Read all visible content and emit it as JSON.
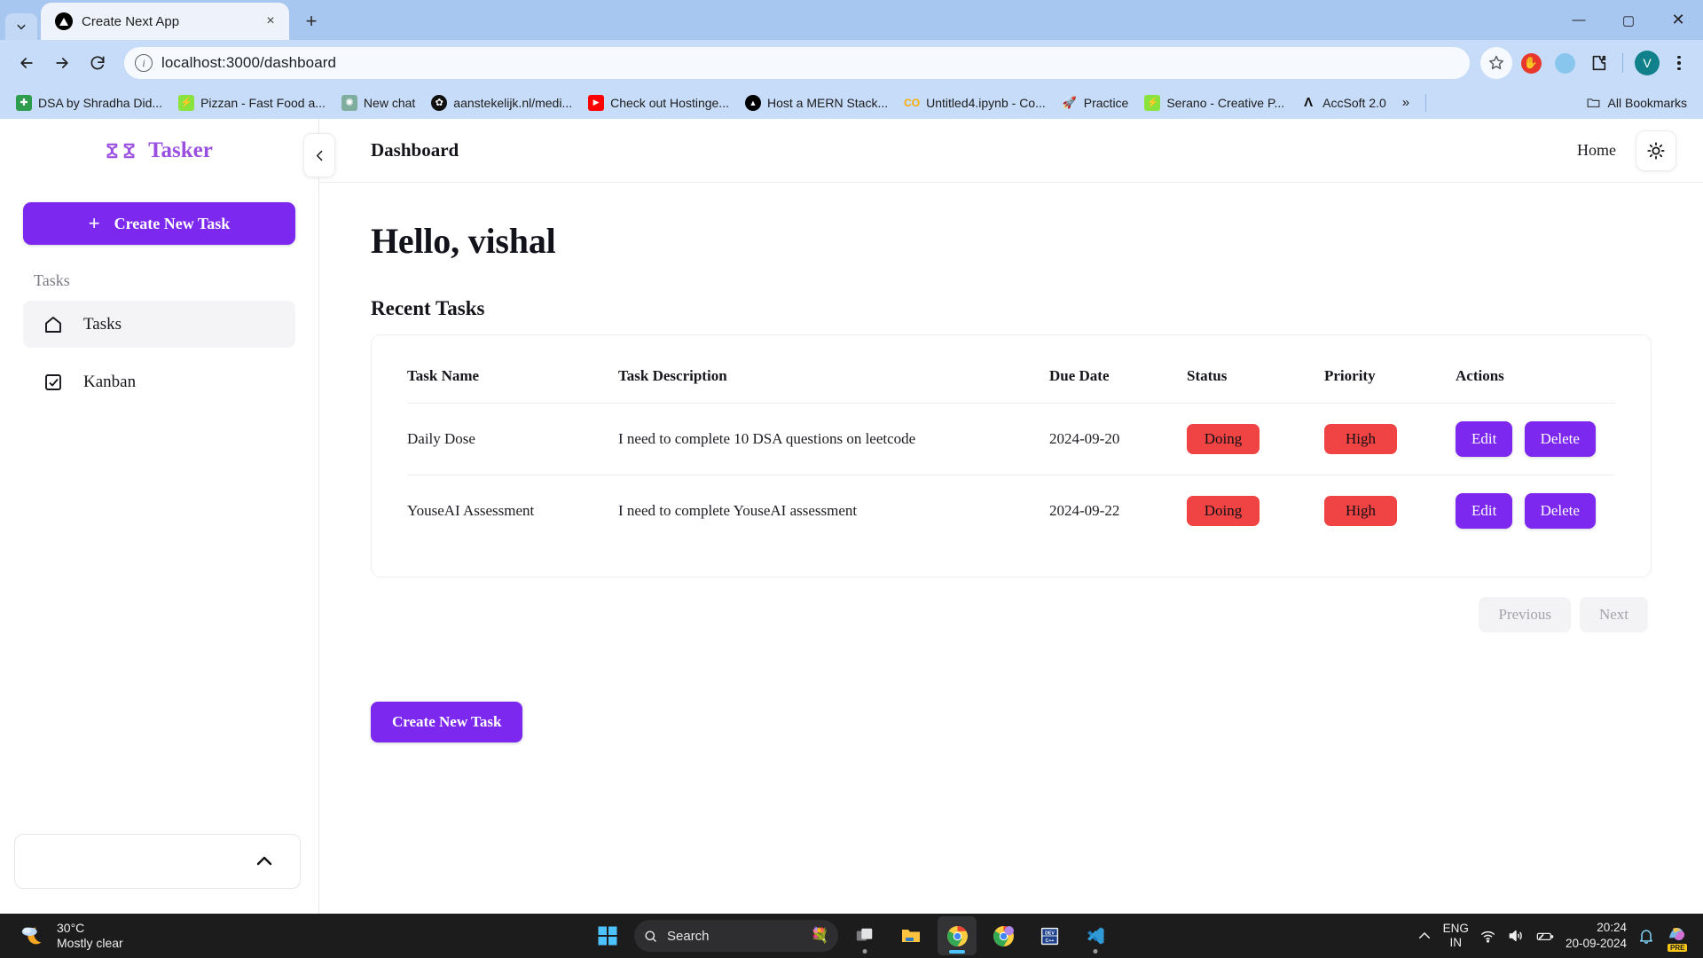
{
  "browser": {
    "tab": {
      "title": "Create Next App",
      "favicon": "nextjs-icon",
      "close": "×"
    },
    "new_tab_label": "+",
    "window_controls": {
      "minimize": "—",
      "maximize": "▢",
      "close": "✕"
    },
    "url": {
      "scheme_hidden": "",
      "text": "localhost:3000/dashboard",
      "host": "localhost:3000",
      "path": "/dashboard"
    },
    "nav": {
      "back": "back-arrow",
      "forward": "forward-arrow",
      "reload": "reload-icon"
    },
    "toolbar_icons": [
      "star-icon",
      "adblock-icon",
      "extension-blue-icon",
      "extensions-puzzle-icon",
      "profile-avatar",
      "chrome-menu-icon"
    ],
    "profile_initial": "V",
    "bookmarks": [
      {
        "label": "DSA by Shradha Did...",
        "icon": "doc-green-icon",
        "color": "#2e9e4e",
        "glyph": "✚"
      },
      {
        "label": "Pizzan - Fast Food a...",
        "icon": "pizzan-icon",
        "color": "#7fe03a",
        "glyph": "⚡"
      },
      {
        "label": "New chat",
        "icon": "chatgpt-icon",
        "color": "#74aa9c",
        "glyph": "✺"
      },
      {
        "label": "aanstekelijk.nl/medi...",
        "icon": "globe-dark-icon",
        "color": "#1a1a1a",
        "glyph": "✿"
      },
      {
        "label": "Check out Hostinge...",
        "icon": "youtube-icon",
        "color": "#ff0000",
        "glyph": "▶"
      },
      {
        "label": "Host a MERN Stack...",
        "icon": "vercel-icon",
        "color": "#000000",
        "glyph": "▲"
      },
      {
        "label": "Untitled4.ipynb - Co...",
        "icon": "colab-icon",
        "color": "#f9ab00",
        "glyph": "CO"
      },
      {
        "label": "Practice",
        "icon": "rocket-icon",
        "color": "#e8f0fe",
        "glyph": "🚀"
      },
      {
        "label": "Serano - Creative P...",
        "icon": "serano-icon",
        "color": "#7fe03a",
        "glyph": "⚡"
      },
      {
        "label": "AccSoft 2.0",
        "icon": "accsoft-icon",
        "color": "#ffffff",
        "glyph": "A"
      }
    ],
    "overflow_label": "»",
    "all_bookmarks_label": "All Bookmarks"
  },
  "sidebar": {
    "brand": {
      "name": "Tasker",
      "logo": "tasker-ticket-icon"
    },
    "create_button": {
      "label": "Create New Task",
      "icon": "plus-icon"
    },
    "section_label": "Tasks",
    "items": [
      {
        "label": "Tasks",
        "icon": "home-icon",
        "active": true
      },
      {
        "label": "Kanban",
        "icon": "checkbox-icon",
        "active": false
      }
    ],
    "footer": {
      "icon": "chevron-up-icon"
    },
    "collapse_icon": "chevron-left-icon"
  },
  "topbar": {
    "title": "Dashboard",
    "home_label": "Home",
    "theme_toggle_icon": "sun-icon"
  },
  "main": {
    "greeting": "Hello, vishal",
    "recent_title": "Recent Tasks",
    "table": {
      "headers": [
        "Task Name",
        "Task Description",
        "Due Date",
        "Status",
        "Priority",
        "Actions"
      ],
      "rows": [
        {
          "name": "Daily Dose",
          "description": "I need to complete 10 DSA questions on leetcode",
          "due_date": "2024-09-20",
          "status": "Doing",
          "priority": "High",
          "edit_label": "Edit",
          "delete_label": "Delete"
        },
        {
          "name": "YouseAI Assessment",
          "description": "I need to complete YouseAI assessment",
          "due_date": "2024-09-22",
          "status": "Doing",
          "priority": "High",
          "edit_label": "Edit",
          "delete_label": "Delete"
        }
      ]
    },
    "pagination": {
      "previous": "Previous",
      "next": "Next"
    },
    "bottom_button": "Create New Task"
  },
  "colors": {
    "brand_purple": "#9b4fe0",
    "button_purple": "#7c28ef",
    "badge_red": "#f04343",
    "sidebar_active": "#f4f4f6"
  },
  "taskbar": {
    "weather": {
      "temperature": "30°C",
      "condition": "Mostly clear",
      "icon": "moon-cloud-icon"
    },
    "start_icon": "windows-start-icon",
    "search_placeholder": "Search",
    "search_icon": "search-icon",
    "apps": [
      "task-view-icon",
      "file-explorer-icon",
      "chrome-icon",
      "chrome-profile-icon",
      "dev-cpp-icon",
      "vscode-icon"
    ],
    "tray": {
      "overflow_icon": "chevron-up-icon",
      "language": {
        "line1": "ENG",
        "line2": "IN"
      },
      "wifi_icon": "wifi-icon",
      "volume_icon": "volume-icon",
      "battery_icon": "battery-icon",
      "time": "20:24",
      "date": "20-09-2024",
      "notification_icon": "bell-icon",
      "copilot_icon": "copilot-icon",
      "copilot_badge": "PRE"
    }
  }
}
